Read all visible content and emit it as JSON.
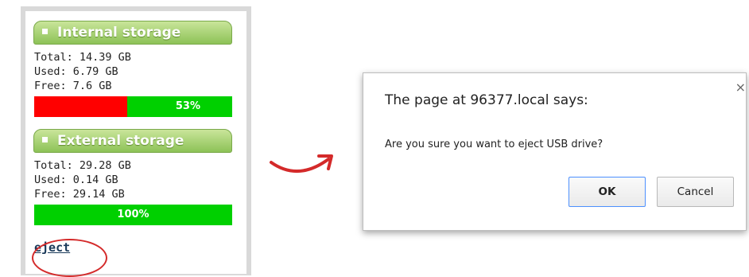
{
  "internal": {
    "header": "Internal storage",
    "total": "Total: 14.39 GB",
    "used": "Used: 6.79 GB",
    "free": "Free: 7.6 GB",
    "percent_label": "53%",
    "free_fraction": 0.53
  },
  "external": {
    "header": "External storage",
    "total": "Total: 29.28 GB",
    "used": "Used: 0.14 GB",
    "free": "Free: 29.14 GB",
    "percent_label": "100%",
    "free_fraction": 1.0
  },
  "eject_label": "eject",
  "dialog": {
    "title": "The page at 96377.local says:",
    "message": "Are you sure you want to eject USB drive?",
    "close": "×",
    "ok_label": "OK",
    "cancel_label": "Cancel"
  },
  "colors": {
    "used_bar": "#ff0000",
    "free_bar": "#00d000",
    "header_green": "#8dc257",
    "annotation_red": "#d42a2a"
  }
}
